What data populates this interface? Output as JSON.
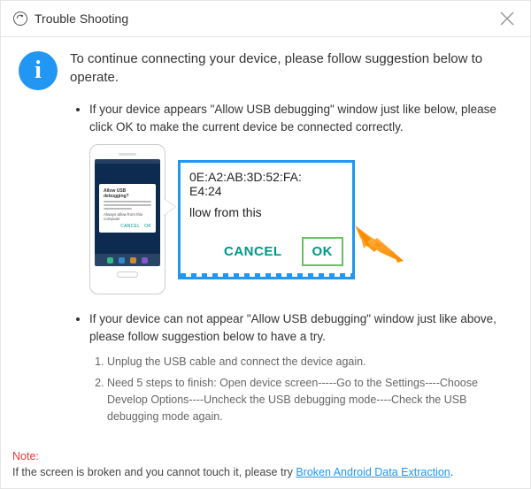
{
  "titlebar": {
    "title": "Trouble Shooting"
  },
  "hero": {
    "info_glyph": "i",
    "text": "To continue connecting your device, please follow suggestion below to operate."
  },
  "step1": {
    "text": "If your device appears \"Allow USB debugging\" window just like below, please click OK to make the current device  be connected correctly."
  },
  "phone_dialog": {
    "title": "Allow USB debugging?",
    "checkbox_label": "Always allow from this computer",
    "cancel": "CANCEL",
    "ok": "OK"
  },
  "zoom": {
    "fingerprint_partial1": "0E:A2:AB:3D:52:FA:",
    "fingerprint_partial2": "E4:24",
    "checkbox_partial": "llow from this",
    "cancel": "CANCEL",
    "ok": "OK"
  },
  "step2": {
    "text": "If your device can not appear \"Allow USB debugging\" window just like above, please follow suggestion below to have a try.",
    "sub1": "Unplug the USB cable and connect the device again.",
    "sub2": "Need 5 steps to finish: Open device screen-----Go to the Settings----Choose Develop Options----Uncheck the USB debugging mode----Check the USB debugging mode again."
  },
  "footer": {
    "label": "Note:",
    "body": "If the screen is broken and you cannot touch it, please try ",
    "link": "Broken Android Data Extraction",
    "tail": "."
  }
}
